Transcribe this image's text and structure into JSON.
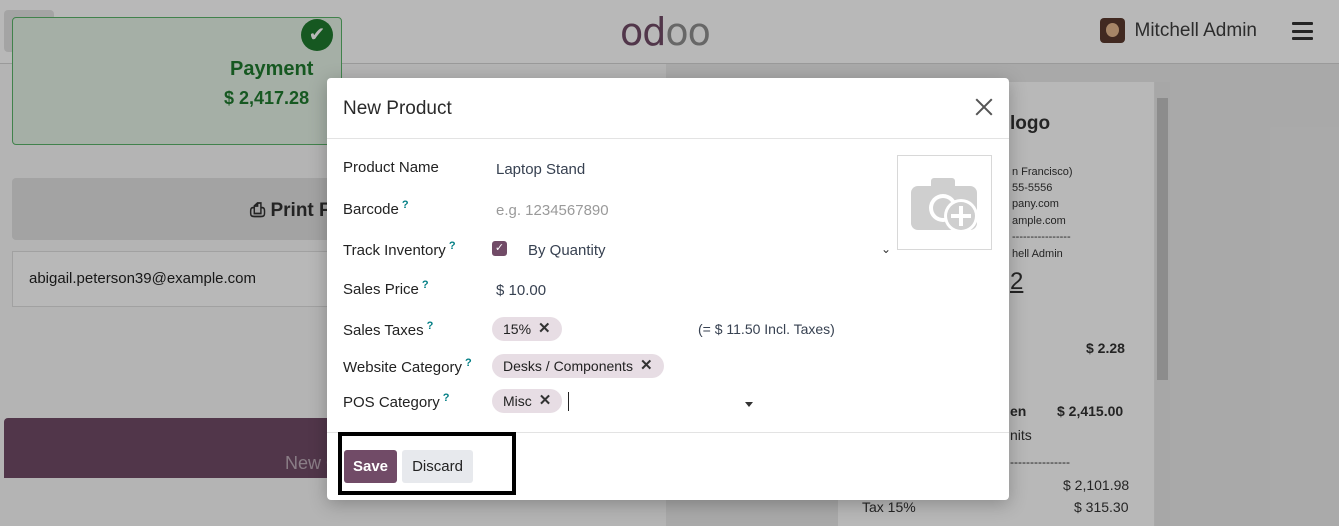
{
  "topbar": {
    "add_icon": "plus-circle-icon",
    "logo_a": "od",
    "logo_b": "oo",
    "user_name": "Mitchell Admin",
    "menu_icon": "hamburger-icon"
  },
  "background": {
    "payment_title": "Payment",
    "payment_amount": "$ 2,417.28",
    "print_label": "Print F",
    "email": "abigail.peterson39@example.com",
    "new_order": "New Order",
    "receipt": {
      "logo": "logo",
      "line1": "n Francisco)",
      "line2": "55-5556",
      "line3": "pany.com",
      "line4": "ample.com",
      "dashes": "----------------",
      "cashier": "hell Admin",
      "order_no": "2",
      "price1": "$ 2.28",
      "item2": "en",
      "item2_price": "$ 2,415.00",
      "units": "nits",
      "dashes2": "---------------",
      "subtotal": "$ 2,101.98",
      "tax_label": "Tax 15%",
      "tax_value": "$ 315.30"
    }
  },
  "modal": {
    "title": "New Product",
    "fields": {
      "product_name_label": "Product Name",
      "product_name_value": "Laptop Stand",
      "barcode_label": "Barcode",
      "barcode_placeholder": "e.g. 1234567890",
      "track_inventory_label": "Track Inventory",
      "track_inventory_value": "By Quantity",
      "sales_price_label": "Sales Price",
      "sales_price_value": "$ 10.00",
      "sales_taxes_label": "Sales Taxes",
      "sales_taxes_tag": "15%",
      "sales_taxes_incl": "(= $ 11.50 Incl. Taxes)",
      "website_category_label": "Website Category",
      "website_category_tag": "Desks / Components",
      "pos_category_label": "POS Category",
      "pos_category_tag": "Misc"
    },
    "help_mark": "?",
    "tag_remove": "✕",
    "save_label": "Save",
    "discard_label": "Discard"
  },
  "colors": {
    "brand": "#714B67",
    "help": "#017e84",
    "success": "#1f7a2e"
  }
}
